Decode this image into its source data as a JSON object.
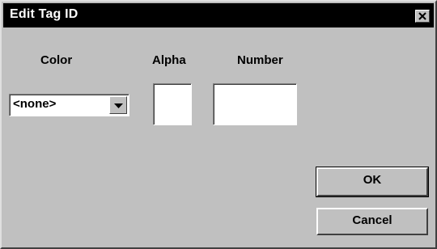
{
  "window": {
    "title": "Edit Tag ID"
  },
  "labels": {
    "color": "Color",
    "alpha": "Alpha",
    "number": "Number"
  },
  "color_select": {
    "value": "<none>"
  },
  "alpha_field": {
    "value": ""
  },
  "number_field": {
    "value": ""
  },
  "buttons": {
    "ok": "OK",
    "cancel": "Cancel"
  },
  "icons": {
    "close": "close-icon",
    "dropdown": "chevron-down-icon"
  },
  "colors": {
    "face": "#c0c0c0",
    "titlebar": "#000000",
    "title_text": "#ffffff"
  }
}
